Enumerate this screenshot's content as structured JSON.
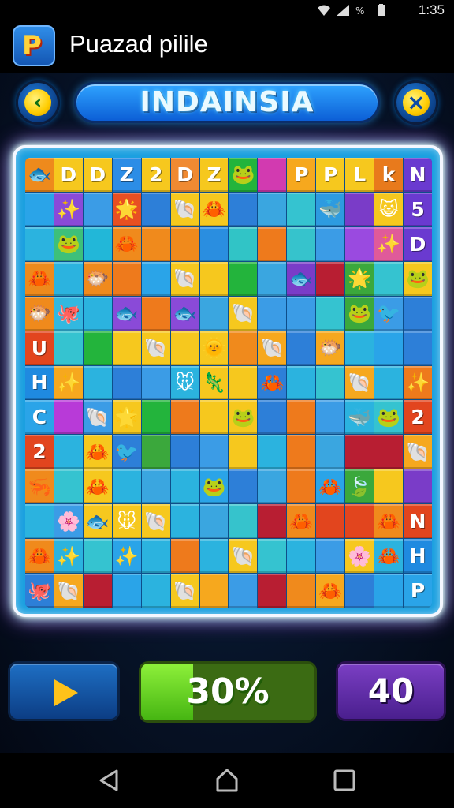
{
  "status_bar": {
    "time": "1:35",
    "icons": [
      "wifi-icon",
      "signal-icon",
      "data-icon",
      "battery-icon"
    ]
  },
  "app_bar": {
    "title": "Puazad pilile",
    "logo_letter": "P"
  },
  "header": {
    "level_name": "INDAINSIA",
    "back_icon": "chevron-left-icon",
    "close_icon": "close-icon"
  },
  "board": {
    "columns": 14,
    "rows": 13,
    "cells": [
      [
        "🐟",
        "D",
        "D",
        "Z",
        "2",
        "D",
        "Z",
        "🐸",
        "",
        "P",
        "P",
        "L",
        "k",
        "N"
      ],
      [
        "",
        "✨",
        "",
        "🌟",
        "",
        "🐚",
        "🦀",
        "",
        "",
        "",
        "🐳",
        "",
        "😺",
        "5"
      ],
      [
        "",
        "🐸",
        "",
        "🦀",
        "",
        "",
        "",
        "",
        "",
        "",
        "",
        "",
        "✨",
        "D"
      ],
      [
        "🦀",
        "",
        "🐡",
        "",
        "",
        "🐚",
        "",
        "",
        "",
        "🐟",
        "",
        "🌟",
        "",
        "🐸"
      ],
      [
        "🐡",
        "🐙",
        "",
        "🐟",
        "",
        "🐟",
        "",
        "🐚",
        "",
        "",
        "",
        "🐸",
        "🐦",
        ""
      ],
      [
        "U",
        "",
        "",
        "",
        "🐚",
        "",
        "🌞",
        "",
        "🐚",
        "",
        "🐡",
        "",
        "",
        ""
      ],
      [
        "H",
        "✨",
        "",
        "",
        "",
        "🐭",
        "🦎",
        "",
        "🦀",
        "",
        "",
        "🐚",
        "",
        "✨"
      ],
      [
        "C",
        "",
        "🐚",
        "🌟",
        "",
        "",
        "",
        "🐸",
        "",
        "",
        "",
        "🐳",
        "🐸",
        "2"
      ],
      [
        "2",
        "",
        "🦀",
        "🐦",
        "",
        "",
        "",
        "",
        "",
        "",
        "",
        "",
        "",
        "🐚"
      ],
      [
        "🦐",
        "",
        "🦀",
        "",
        "",
        "",
        "🐸",
        "",
        "",
        "",
        "🦀",
        "🍃",
        "",
        ""
      ],
      [
        "",
        "🌸",
        "🐟",
        "🐭",
        "🐚",
        "",
        "",
        "",
        "",
        "🦀",
        "",
        "",
        "🦀",
        "N"
      ],
      [
        "🦀",
        "✨",
        "",
        "✨",
        "",
        "",
        "",
        "🐚",
        "",
        "",
        "",
        "🌸",
        "🦀",
        "H"
      ],
      [
        "🐙",
        "🐚",
        "",
        "",
        "",
        "🐚",
        "",
        "",
        "",
        "",
        "🦀",
        "",
        "",
        "P"
      ]
    ],
    "colors": [
      [
        "#ee8a1c",
        "#f6c81e",
        "#f6c81e",
        "#2c8de6",
        "#f6c81e",
        "#f08a32",
        "#f6c81e",
        "#23b43c",
        "#d23ab0",
        "#f6a81e",
        "#f6c81e",
        "#f6c81e",
        "#e87a1c",
        "#6a3ad0"
      ],
      [
        "#2aa4e8",
        "#8a4ad8",
        "#3b9ce6",
        "#e84f22",
        "#2d7fd8",
        "#f6c81e",
        "#f6c81e",
        "#2d7fd8",
        "#3aa6e0",
        "#35c3d0",
        "#2d9be0",
        "#7a3cc8",
        "#f6c81e",
        "#6a3ad0"
      ],
      [
        "#2bb3df",
        "#3dc07a",
        "#22b7d8",
        "#f08a1c",
        "#f08a1c",
        "#f08a1c",
        "#2a8ee0",
        "#31c4c6",
        "#ee7a1c",
        "#36c3cc",
        "#3b9ce6",
        "#9a4ae0",
        "#e05a9a",
        "#6a3ad0"
      ],
      [
        "#ee8a1c",
        "#2bb3df",
        "#f08a1c",
        "#ee7a1c",
        "#2aa4e8",
        "#f6c81e",
        "#f6c81e",
        "#23b43c",
        "#3aa6e0",
        "#7a3cc8",
        "#b81e32",
        "#3ba83c",
        "#35c3d0",
        "#f6c81e"
      ],
      [
        "#f08a1c",
        "#32b8e0",
        "#2bb3df",
        "#8a4ad8",
        "#ee7a1c",
        "#8a4ad8",
        "#3aa6e0",
        "#f6c81e",
        "#3b9ce6",
        "#3b9ce6",
        "#35c3d0",
        "#3ba83c",
        "#3b9ce6",
        "#2d7fd8"
      ],
      [
        "#e2451e",
        "#35c3d0",
        "#23b43c",
        "#f6c81e",
        "#f6c81e",
        "#f6c81e",
        "#f6c81e",
        "#f08a1c",
        "#f6a81e",
        "#2d7fd8",
        "#f6a81e",
        "#2bb3df",
        "#2aa4e8",
        "#2d7fd8"
      ],
      [
        "#1f8ae0",
        "#f6a81e",
        "#2bb3df",
        "#2d7fd8",
        "#3b9ce6",
        "#2bb3df",
        "#f6c81e",
        "#f6c81e",
        "#2d7fd8",
        "#2bb3df",
        "#35c3d0",
        "#f6a81e",
        "#2bb3df",
        "#ee7a1c"
      ],
      [
        "#2aa4e8",
        "#b83ad8",
        "#3b9ce6",
        "#f6c81e",
        "#23b43c",
        "#ee7a1c",
        "#f6c81e",
        "#f6c81e",
        "#2d7fd8",
        "#ee7a1c",
        "#3b9ce6",
        "#2bb3df",
        "#35c3d0",
        "#e2451e"
      ],
      [
        "#e2451e",
        "#2bb3df",
        "#f6c81e",
        "#2d7fd8",
        "#3ba83c",
        "#2d7fd8",
        "#3b9ce6",
        "#f6c81e",
        "#2bb3df",
        "#ee7a1c",
        "#3aa6e0",
        "#b81e32",
        "#b81e32",
        "#f6a81e"
      ],
      [
        "#f08a1c",
        "#35c3d0",
        "#f6c81e",
        "#2bb3df",
        "#3aa6e0",
        "#2bb3df",
        "#2aa4e8",
        "#2d7fd8",
        "#3aa6e0",
        "#ee7a1c",
        "#2aa4e8",
        "#3ba83c",
        "#f6c81e",
        "#7a3cc8"
      ],
      [
        "#2bb3df",
        "#3b9ce6",
        "#f6c81e",
        "#f6c81e",
        "#f6c81e",
        "#2bb3df",
        "#3aa6e0",
        "#36c3cc",
        "#b81e32",
        "#f08a1c",
        "#e2451e",
        "#e2451e",
        "#f08a1c",
        "#e2451e"
      ],
      [
        "#f08a1c",
        "#2bb3df",
        "#35c3d0",
        "#2aa4e8",
        "#2bb3df",
        "#ee7a1c",
        "#2bb3df",
        "#f6c81e",
        "#35c3d0",
        "#2bb3df",
        "#3b9ce6",
        "#f6c81e",
        "#2bb3df",
        "#1f8ae0"
      ],
      [
        "#2d7fd8",
        "#f6a81e",
        "#b81e32",
        "#2aa4e8",
        "#2bb3df",
        "#f6c81e",
        "#f6a81e",
        "#3b9ce6",
        "#b81e32",
        "#f08a1c",
        "#f6a81e",
        "#2d7fd8",
        "#2aa4e8",
        "#2aa4e8"
      ]
    ]
  },
  "controls": {
    "play_icon": "play-icon",
    "progress_percent": 30,
    "progress_label": "30%",
    "score": "40"
  },
  "nav_bar": {
    "icons": [
      "back-triangle-icon",
      "home-icon",
      "recents-square-icon"
    ]
  }
}
